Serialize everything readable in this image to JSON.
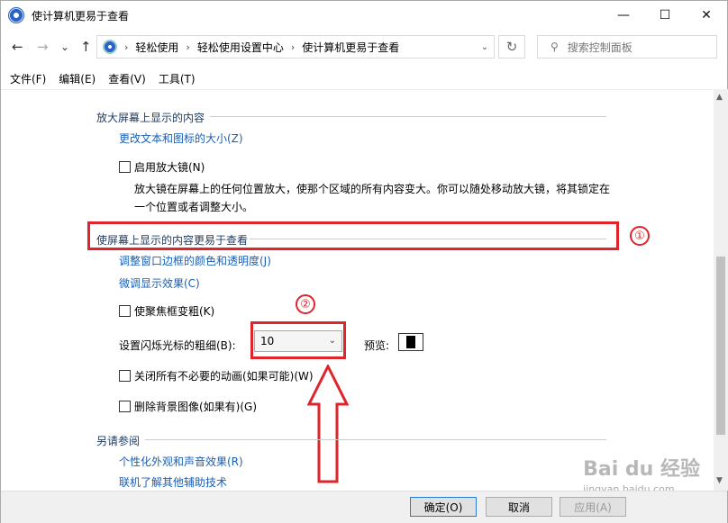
{
  "window": {
    "title": "使计算机更易于查看",
    "controls": [
      "—",
      "☐",
      "✕"
    ]
  },
  "nav": {
    "back": "←",
    "forward": "→",
    "dropdown": "⌄",
    "up": "↑",
    "breadcrumb": [
      "轻松使用",
      "轻松使用设置中心",
      "使计算机更易于查看"
    ],
    "refresh": "↻",
    "search_placeholder": "搜索控制面板"
  },
  "menu": [
    "文件(F)",
    "编辑(E)",
    "查看(V)",
    "工具(T)"
  ],
  "sections": {
    "magnify": {
      "heading": "放大屏幕上显示的内容",
      "link": "更改文本和图标的大小(Z)",
      "checkbox": "启用放大镜(N)",
      "description_line1": "放大镜在屏幕上的任何位置放大，使那个区域的所有内容变大。你可以随处移动放大镜，将其锁定在",
      "description_line2": "一个位置或者调整大小。"
    },
    "easier": {
      "heading": "使屏幕上显示的内容更易于查看",
      "link1": "调整窗口边框的颜色和透明度(J)",
      "link2": "微调显示效果(C)",
      "checkbox_focus": "使聚焦框变粗(K)",
      "cursor_label": "设置闪烁光标的粗细(B):",
      "cursor_value": "10",
      "preview_label": "预览:",
      "checkbox_anim": "关闭所有不必要的动画(如果可能)(W)",
      "checkbox_bg": "删除背景图像(如果有)(G)"
    },
    "seealso": {
      "heading": "另请参阅",
      "link1": "个性化外观和声音效果(R)",
      "link2": "联机了解其他辅助技术"
    }
  },
  "annotations": {
    "marker1": "①",
    "marker2": "②",
    "color": "#e0242b"
  },
  "buttons": {
    "ok": "确定(O)",
    "cancel": "取消",
    "apply": "应用(A)"
  },
  "watermark": {
    "brand": "Bai du 经验",
    "url": "jingyan.baidu.com"
  }
}
